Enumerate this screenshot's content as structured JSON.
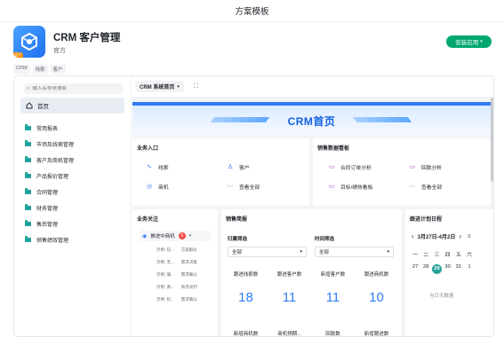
{
  "window": {
    "title": "方案模板"
  },
  "app": {
    "name": "CRM 客户管理",
    "publisher": "官方",
    "logo_badge": "官方",
    "install_label": "安装应用",
    "tags": [
      "CRM",
      "线索",
      "客户"
    ]
  },
  "sidebar": {
    "search_placeholder": "输入名称来搜索",
    "home": "首页",
    "items": [
      "常用报表",
      "市场及线索管理",
      "客户及商机管理",
      "产品报价管理",
      "合同管理",
      "财务管理",
      "售后管理",
      "销售绩效管理"
    ]
  },
  "toolbar": {
    "page_selector": "CRM 系统首页"
  },
  "banner": {
    "title": "CRM首页"
  },
  "business_entry": {
    "title": "业务入口",
    "items": [
      {
        "label": "线索",
        "icon": "lead-icon"
      },
      {
        "label": "客户",
        "icon": "customer-icon"
      },
      {
        "label": "商机",
        "icon": "opportunity-icon"
      },
      {
        "label": "查看全部",
        "icon": "more-icon"
      }
    ]
  },
  "sales_dashboard": {
    "title": "销售数据看板",
    "items": [
      {
        "label": "合同订单分析",
        "icon": "contract-chart-icon"
      },
      {
        "label": "回款分析",
        "icon": "payment-chart-icon"
      },
      {
        "label": "目标/绩效看板",
        "icon": "target-chart-icon"
      },
      {
        "label": "查看全部",
        "icon": "more-icon"
      }
    ]
  },
  "business_follow": {
    "title": "业务关注",
    "item": {
      "label": "推进中商机",
      "count": "9"
    },
    "rows": [
      [
        "示例: 任...",
        "方案报价"
      ],
      [
        "示例: 无...",
        "需求决策"
      ],
      [
        "示例: 珊...",
        "需求确认"
      ],
      [
        "示例: 谢...",
        "商务谈判"
      ],
      [
        "示例: 机...",
        "需求确认"
      ]
    ]
  },
  "sales_brief": {
    "title": "销售简报",
    "owner_label": "归属筛选",
    "owner_value": "全部",
    "time_label": "时间筛选",
    "time_value": "全部",
    "stats": [
      {
        "label": "跟进线索数",
        "value": "18"
      },
      {
        "label": "跟进客户数",
        "value": "11"
      },
      {
        "label": "新增客户数",
        "value": "11"
      },
      {
        "label": "跟进商机数",
        "value": "10"
      }
    ],
    "stats_row2": [
      "新增商机数",
      "商机预期...",
      "回款数",
      "新增跟进数"
    ]
  },
  "calendar": {
    "title": "跟进计划日程",
    "range": "3月27日-4月2日",
    "weekdays": [
      "一",
      "二",
      "三",
      "四",
      "五",
      "六"
    ],
    "days": [
      "27",
      "28",
      "29",
      "30",
      "31",
      "1"
    ],
    "today": "29",
    "empty_text": "当日无数据"
  },
  "colors": {
    "accent": "#2f7cf6",
    "install": "#00a870",
    "teal": "#1aa39a",
    "badge": "#f54a45"
  }
}
